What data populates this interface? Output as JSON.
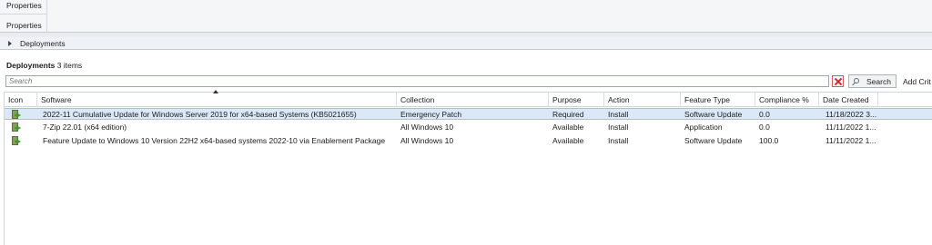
{
  "ribbon": {
    "group_label_top": "Properties",
    "group_label_bottom": "Properties"
  },
  "nav": {
    "label": "Deployments"
  },
  "results": {
    "title": "Deployments",
    "count": "3 items"
  },
  "search": {
    "placeholder": "Search",
    "button_label": "Search",
    "add_criteria_label": "Add Crit"
  },
  "grid": {
    "columns": [
      {
        "key": "icon",
        "label": "Icon"
      },
      {
        "key": "software",
        "label": "Software"
      },
      {
        "key": "collection",
        "label": "Collection"
      },
      {
        "key": "purpose",
        "label": "Purpose"
      },
      {
        "key": "action",
        "label": "Action"
      },
      {
        "key": "feature_type",
        "label": "Feature Type"
      },
      {
        "key": "compliance",
        "label": "Compliance %"
      },
      {
        "key": "date_created",
        "label": "Date Created"
      }
    ],
    "rows": [
      {
        "selected": true,
        "software": "2022-11 Cumulative Update for Windows Server 2019 for x64-based Systems (KB5021655)",
        "collection": "Emergency Patch",
        "purpose": "Required",
        "action": "Install",
        "feature_type": "Software Update",
        "compliance": "0.0",
        "date_created": "11/18/2022 3..."
      },
      {
        "selected": false,
        "software": "7-Zip 22.01 (x64 edition)",
        "collection": "All Windows 10",
        "purpose": "Available",
        "action": "Install",
        "feature_type": "Application",
        "compliance": "0.0",
        "date_created": "11/11/2022 1..."
      },
      {
        "selected": false,
        "software": "Feature Update to Windows 10 Version 22H2 x64-based systems 2022-10 via Enablement Package",
        "collection": "All Windows 10",
        "purpose": "Available",
        "action": "Install",
        "feature_type": "Software Update",
        "compliance": "100.0",
        "date_created": "11/11/2022 1..."
      }
    ]
  },
  "icons": {
    "row_icon": "deployment-icon",
    "clear": "close-icon",
    "search": "search-icon",
    "expand": "chevron-right-icon",
    "sort": "sort-ascending-icon"
  },
  "colors": {
    "selected_row": "#dbe8f8",
    "clear_red": "#d42a2a"
  }
}
